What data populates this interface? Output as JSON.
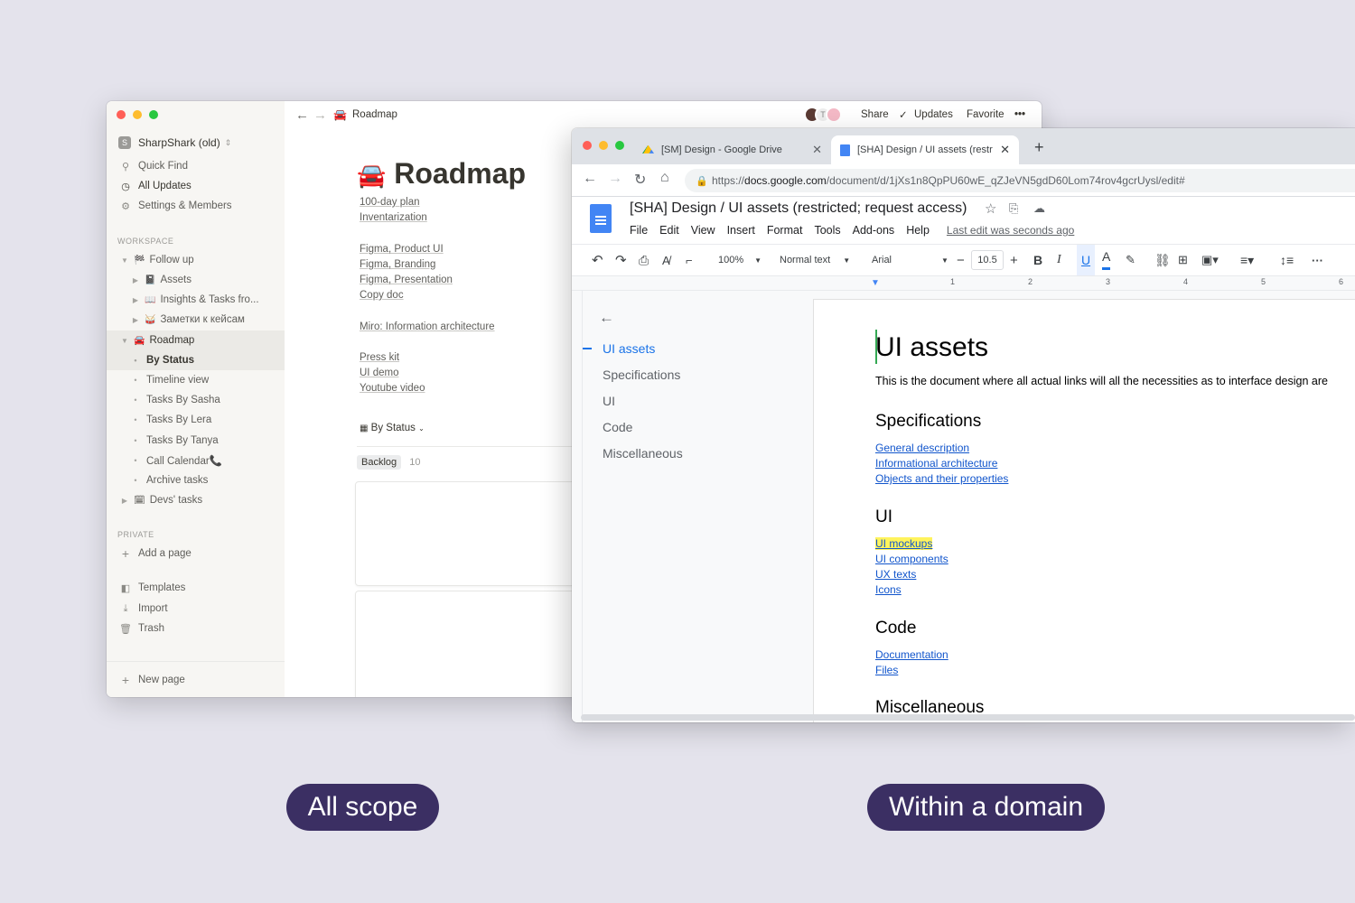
{
  "notion": {
    "workspace": "SharpShark (old)",
    "workspace_badge": "S",
    "nav": [
      "Quick Find",
      "All Updates",
      "Settings & Members"
    ],
    "section_workspace": "WORKSPACE",
    "tree": [
      {
        "icon": "🏁",
        "label": "Follow up",
        "type": "parent"
      },
      {
        "icon": "📓",
        "label": "Assets",
        "type": "child"
      },
      {
        "icon": "📖",
        "label": "Insights & Tasks fro...",
        "type": "child"
      },
      {
        "icon": "🥁",
        "label": "Заметки к кейсам",
        "type": "child"
      },
      {
        "icon": "🚘",
        "label": "Roadmap",
        "type": "parent-open"
      }
    ],
    "views": [
      "By Status",
      "Timeline view",
      "Tasks By Sasha",
      "Tasks By Lera",
      "Tasks By Tanya",
      "Call Calendar📞",
      "Archive tasks"
    ],
    "devs_icon": "🗓",
    "devs": "Devs' tasks",
    "section_private": "PRIVATE",
    "add_page": "Add a page",
    "tools": [
      "Templates",
      "Import",
      "Trash"
    ],
    "new_page": "New page",
    "breadcrumb_icon": "🚘",
    "breadcrumb": "Roadmap",
    "top_actions": {
      "share": "Share",
      "updates": "Updates",
      "favorite": "Favorite",
      "more": "•••"
    },
    "avatar_letter": "T",
    "title_icon": "🚘",
    "title": "Roadmap",
    "links_group1": [
      "100-day plan",
      "Inventarization"
    ],
    "links_group2": [
      "Figma, Product UI",
      "Figma, Branding",
      "Figma, Presentation",
      "Copy doc"
    ],
    "links_group3": [
      "Miro: Information architecture"
    ],
    "links_group4": [
      "Press kit",
      "UI demo",
      "Youtube video"
    ],
    "view_selector": "By Status",
    "group_label": "Backlog",
    "group_count": "10",
    "group_more": "•••"
  },
  "chrome": {
    "tab1": "[SM] Design - Google Drive",
    "tab2": "[SHA] Design / UI assets (restr",
    "url_prefix": "https://",
    "url_domain": "docs.google.com",
    "url_path": "/document/d/1jXs1n8QpPU60wE_qZJeVN5gdD60Lom74rov4gcrUysl/edit#",
    "doc_title": "[SHA] Design / UI assets (restricted; request access)",
    "menu": [
      "File",
      "Edit",
      "View",
      "Insert",
      "Format",
      "Tools",
      "Add-ons",
      "Help"
    ],
    "last_edit": "Last edit was seconds ago",
    "toolbar": {
      "zoom": "100%",
      "style": "Normal text",
      "font": "Arial",
      "size": "10.5"
    },
    "ruler_numbers": [
      "1",
      "2",
      "3",
      "4",
      "5",
      "6"
    ],
    "outline": [
      "UI assets",
      "Specifications",
      "UI",
      "Code",
      "Miscellaneous"
    ],
    "doc": {
      "heading": "UI assets",
      "intro": "This is the document where all actual links will all the necessities as to interface design are",
      "sections": [
        {
          "title": "Specifications",
          "links": [
            "General description",
            "Informational architecture",
            "Objects and their properties"
          ]
        },
        {
          "title": "UI",
          "links": [
            "UI mockups",
            "UI components",
            "UX texts",
            "Icons"
          ]
        },
        {
          "title": "Code",
          "links": [
            "Documentation",
            "Files"
          ]
        },
        {
          "title": "Miscellaneous",
          "links": []
        }
      ]
    },
    "highlight_color": "#fff35c"
  },
  "labels": {
    "left": "All scope",
    "right": "Within a domain"
  }
}
